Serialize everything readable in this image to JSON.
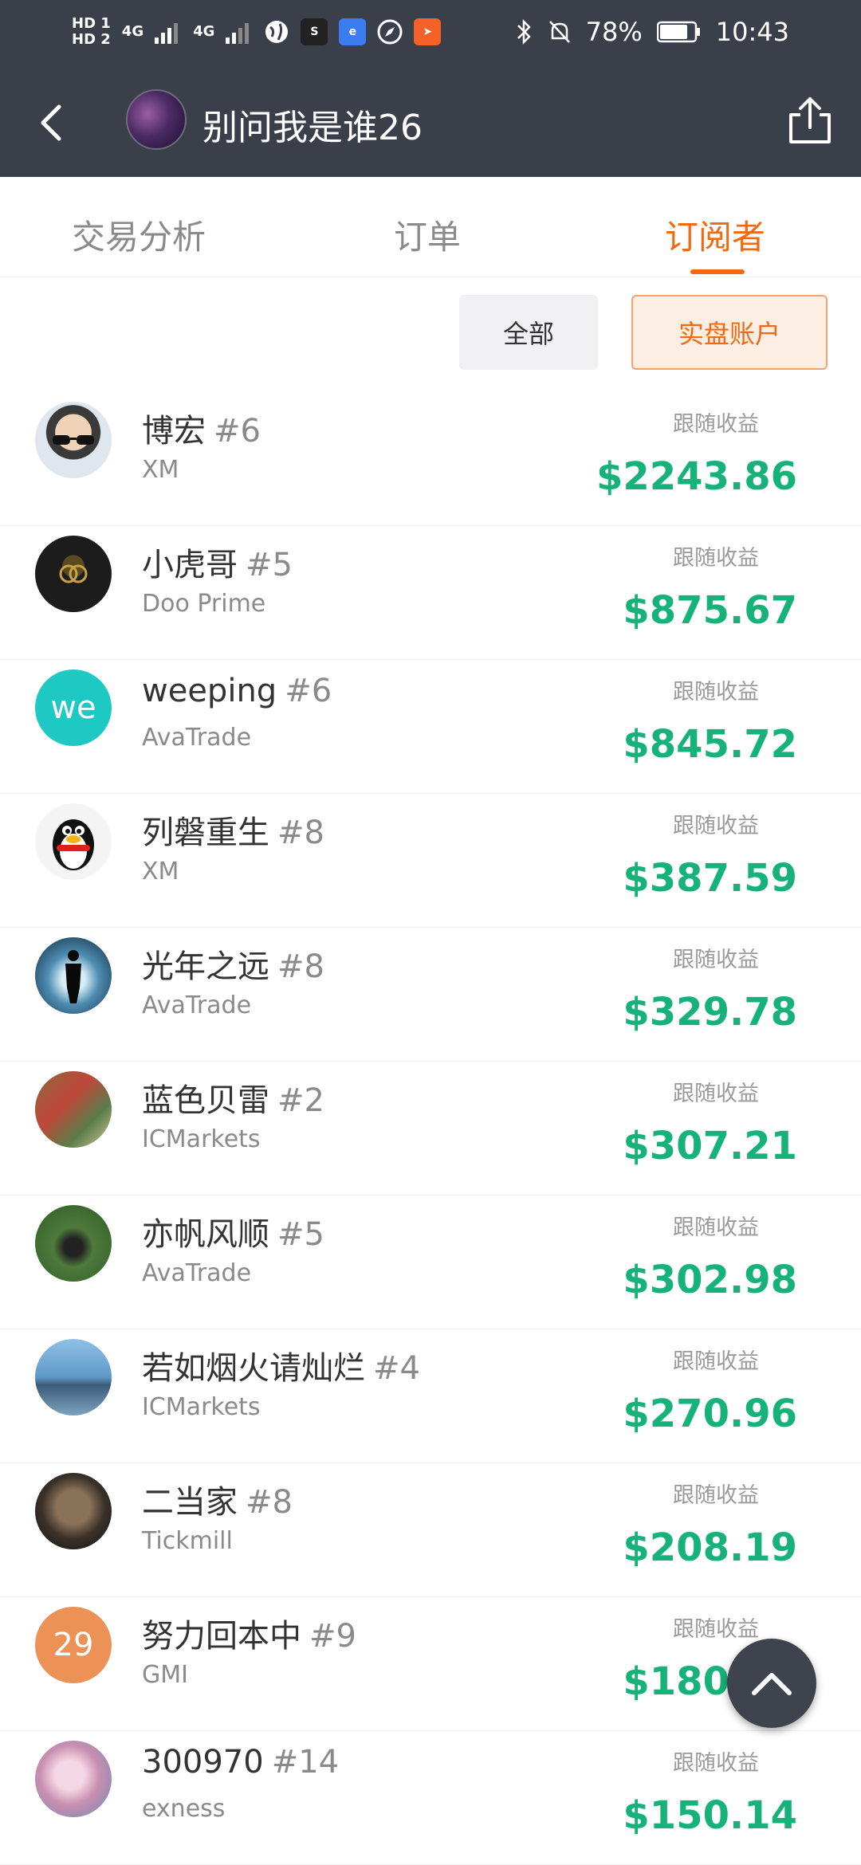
{
  "status": {
    "sim1": "HD 1",
    "sim2": "HD 2",
    "net1": "4G",
    "net2": "4G",
    "battery": "78%",
    "time": "10:43"
  },
  "header": {
    "title": "别问我是谁26"
  },
  "tabs": [
    {
      "label": "交易分析"
    },
    {
      "label": "订单"
    },
    {
      "label": "订阅者"
    }
  ],
  "filters": {
    "all": "全部",
    "real": "实盘账户"
  },
  "subscribers": [
    {
      "name": "博宏",
      "rank": "#6",
      "broker": "XM",
      "gain_label": "跟随收益",
      "gain": "$2243.86",
      "avatar": "photo"
    },
    {
      "name": "小虎哥",
      "rank": "#5",
      "broker": "Doo Prime",
      "gain_label": "跟随收益",
      "gain": "$875.67",
      "avatar": "photo"
    },
    {
      "name": "weeping",
      "rank": "#6",
      "broker": "AvaTrade",
      "gain_label": "跟随收益",
      "gain": "$845.72",
      "avatar": "we"
    },
    {
      "name": "列磐重生",
      "rank": "#8",
      "broker": "XM",
      "gain_label": "跟随收益",
      "gain": "$387.59",
      "avatar": "penguin"
    },
    {
      "name": "光年之远",
      "rank": "#8",
      "broker": "AvaTrade",
      "gain_label": "跟随收益",
      "gain": "$329.78",
      "avatar": "photo"
    },
    {
      "name": "蓝色贝雷",
      "rank": "#2",
      "broker": "ICMarkets",
      "gain_label": "跟随收益",
      "gain": "$307.21",
      "avatar": "photo"
    },
    {
      "name": "亦帆风顺",
      "rank": "#5",
      "broker": "AvaTrade",
      "gain_label": "跟随收益",
      "gain": "$302.98",
      "avatar": "photo"
    },
    {
      "name": "若如烟火请灿烂",
      "rank": "#4",
      "broker": "ICMarkets",
      "gain_label": "跟随收益",
      "gain": "$270.96",
      "avatar": "photo"
    },
    {
      "name": "二当家",
      "rank": "#8",
      "broker": "Tickmill",
      "gain_label": "跟随收益",
      "gain": "$208.19",
      "avatar": "photo"
    },
    {
      "name": "努力回本中",
      "rank": "#9",
      "broker": "GMI",
      "gain_label": "跟随收益",
      "gain": "$180.32",
      "avatar": "29"
    },
    {
      "name": "300970",
      "rank": "#14",
      "broker": "exness",
      "gain_label": "跟随收益",
      "gain": "$150.14",
      "avatar": "photo"
    }
  ],
  "colors": {
    "accent": "#f06a14",
    "gain": "#16b27a",
    "topbar": "#3b3f4a"
  }
}
